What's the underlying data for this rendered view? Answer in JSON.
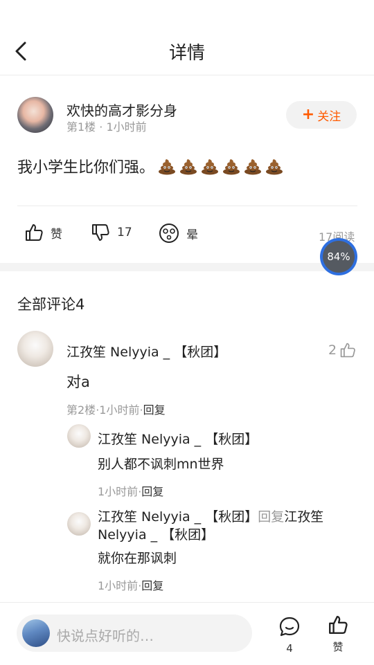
{
  "header": {
    "title": "详情"
  },
  "post": {
    "author": "欢快的高才影分身",
    "floor": "第1楼",
    "separator": "·",
    "time": "1小时前",
    "follow_label": "关注",
    "follow_plus": "+",
    "text": "我小学生比你们强。",
    "emoji_name": "poop-emoji",
    "emoji_count": 6
  },
  "actions": {
    "like_label": "赞",
    "dislike_count": "17",
    "dizzy_label": "晕",
    "reads": "17阅读",
    "progress": "84%"
  },
  "comments": {
    "title": "全部评论4",
    "items": [
      {
        "author": "江孜笙 Nelyyia _ 【秋团】",
        "likes": "2",
        "text": "对a",
        "floor": "第2楼",
        "sep": "·",
        "time": "1小时前",
        "reply_label": "回复",
        "replies": [
          {
            "author": "江孜笙 Nelyyia _ 【秋团】",
            "text": "别人都不讽刺mn世界",
            "time": "1小时前",
            "sep": "·",
            "reply_label": "回复"
          },
          {
            "author": "江孜笙 Nelyyia _ 【秋团】",
            "reply_word": "回复",
            "reply_to": "江孜笙 Nelyyia _ 【秋团】",
            "text": "就你在那讽刺",
            "time": "1小时前",
            "sep": "·",
            "reply_label": "回复"
          }
        ]
      }
    ]
  },
  "bottom": {
    "placeholder": "快说点好听的…",
    "comment_count": "4",
    "like_label": "赞"
  },
  "colors": {
    "accent": "#ff5a00",
    "progress": "#2e6fe0",
    "muted": "#999999"
  }
}
